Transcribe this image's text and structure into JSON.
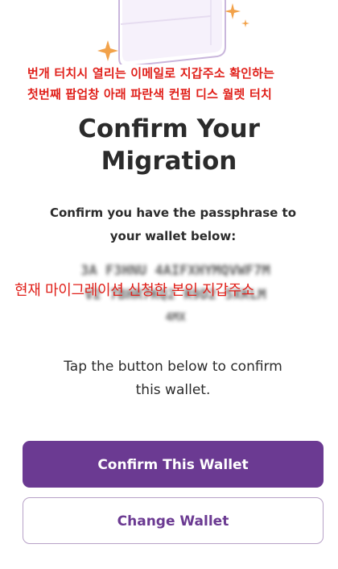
{
  "annotations": {
    "line1": "번개 터치시 열리는 이메일로 지갑주소 확인하는",
    "line2": "첫번째 팝업창 아래 파란색 컨펌 디스 월렛 터치",
    "line3": "현재 마이그레이션 신청한 본인 지갑주소"
  },
  "content": {
    "title_line1": "Confirm Your",
    "title_line2": "Migration",
    "subtitle_line1": "Confirm you have the passphrase to",
    "subtitle_line2": "your wallet below:",
    "passphrase_blur_line1": "3A F3HNU 4AIFXHYMQVWF7M",
    "passphrase_blur_line2": "V2 7BHR7KQ2 R9D2 5XKLM",
    "passphrase_blur_line3": "4MX",
    "instruction_line1": "Tap the button below to confirm",
    "instruction_line2": "this wallet."
  },
  "buttons": {
    "confirm_label": "Confirm This Wallet",
    "change_label": "Change Wallet"
  },
  "colors": {
    "brand_purple": "#6b3a92",
    "annotation_red": "#e0201a",
    "sparkle": "#f2a24a"
  }
}
